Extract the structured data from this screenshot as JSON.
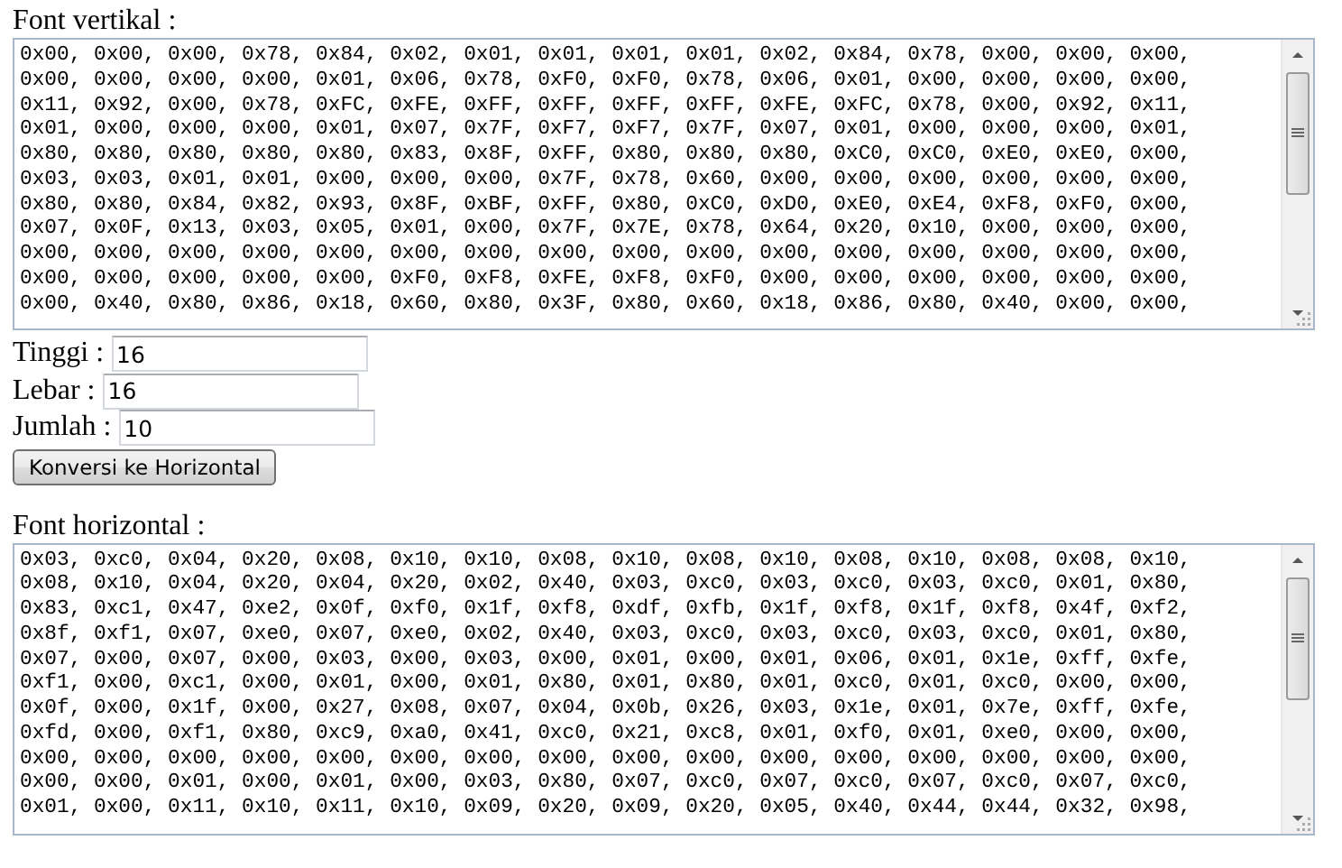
{
  "vertical": {
    "label": "Font vertikal :",
    "lines": [
      "0x00, 0x00, 0x00, 0x78, 0x84, 0x02, 0x01, 0x01, 0x01, 0x01, 0x02, 0x84, 0x78, 0x00, 0x00, 0x00,",
      "0x00, 0x00, 0x00, 0x00, 0x01, 0x06, 0x78, 0xF0, 0xF0, 0x78, 0x06, 0x01, 0x00, 0x00, 0x00, 0x00,",
      "0x11, 0x92, 0x00, 0x78, 0xFC, 0xFE, 0xFF, 0xFF, 0xFF, 0xFF, 0xFE, 0xFC, 0x78, 0x00, 0x92, 0x11,",
      "0x01, 0x00, 0x00, 0x00, 0x01, 0x07, 0x7F, 0xF7, 0xF7, 0x7F, 0x07, 0x01, 0x00, 0x00, 0x00, 0x01,",
      "0x80, 0x80, 0x80, 0x80, 0x80, 0x83, 0x8F, 0xFF, 0x80, 0x80, 0x80, 0xC0, 0xC0, 0xE0, 0xE0, 0x00,",
      "0x03, 0x03, 0x01, 0x01, 0x00, 0x00, 0x00, 0x7F, 0x78, 0x60, 0x00, 0x00, 0x00, 0x00, 0x00, 0x00,",
      "0x80, 0x80, 0x84, 0x82, 0x93, 0x8F, 0xBF, 0xFF, 0x80, 0xC0, 0xD0, 0xE0, 0xE4, 0xF8, 0xF0, 0x00,",
      "0x07, 0x0F, 0x13, 0x03, 0x05, 0x01, 0x00, 0x7F, 0x7E, 0x78, 0x64, 0x20, 0x10, 0x00, 0x00, 0x00,",
      "0x00, 0x00, 0x00, 0x00, 0x00, 0x00, 0x00, 0x00, 0x00, 0x00, 0x00, 0x00, 0x00, 0x00, 0x00, 0x00,",
      "0x00, 0x00, 0x00, 0x00, 0x00, 0xF0, 0xF8, 0xFE, 0xF8, 0xF0, 0x00, 0x00, 0x00, 0x00, 0x00, 0x00,",
      "0x00, 0x40, 0x80, 0x86, 0x18, 0x60, 0x80, 0x3F, 0x80, 0x60, 0x18, 0x86, 0x80, 0x40, 0x00, 0x00,"
    ]
  },
  "fields": [
    {
      "label": "Tinggi :",
      "value": "16"
    },
    {
      "label": "Lebar :",
      "value": "16"
    },
    {
      "label": "Jumlah :",
      "value": "10"
    }
  ],
  "button": "Konversi ke Horizontal",
  "horizontal": {
    "label": "Font horizontal :",
    "lines": [
      "0x03, 0xc0, 0x04, 0x20, 0x08, 0x10, 0x10, 0x08, 0x10, 0x08, 0x10, 0x08, 0x10, 0x08, 0x08, 0x10,",
      "0x08, 0x10, 0x04, 0x20, 0x04, 0x20, 0x02, 0x40, 0x03, 0xc0, 0x03, 0xc0, 0x03, 0xc0, 0x01, 0x80,",
      "0x83, 0xc1, 0x47, 0xe2, 0x0f, 0xf0, 0x1f, 0xf8, 0xdf, 0xfb, 0x1f, 0xf8, 0x1f, 0xf8, 0x4f, 0xf2,",
      "0x8f, 0xf1, 0x07, 0xe0, 0x07, 0xe0, 0x02, 0x40, 0x03, 0xc0, 0x03, 0xc0, 0x03, 0xc0, 0x01, 0x80,",
      "0x07, 0x00, 0x07, 0x00, 0x03, 0x00, 0x03, 0x00, 0x01, 0x00, 0x01, 0x06, 0x01, 0x1e, 0xff, 0xfe,",
      "0xf1, 0x00, 0xc1, 0x00, 0x01, 0x00, 0x01, 0x80, 0x01, 0x80, 0x01, 0xc0, 0x01, 0xc0, 0x00, 0x00,",
      "0x0f, 0x00, 0x1f, 0x00, 0x27, 0x08, 0x07, 0x04, 0x0b, 0x26, 0x03, 0x1e, 0x01, 0x7e, 0xff, 0xfe,",
      "0xfd, 0x00, 0xf1, 0x80, 0xc9, 0xa0, 0x41, 0xc0, 0x21, 0xc8, 0x01, 0xf0, 0x01, 0xe0, 0x00, 0x00,",
      "0x00, 0x00, 0x00, 0x00, 0x00, 0x00, 0x00, 0x00, 0x00, 0x00, 0x00, 0x00, 0x00, 0x00, 0x00, 0x00,",
      "0x00, 0x00, 0x01, 0x00, 0x01, 0x00, 0x03, 0x80, 0x07, 0xc0, 0x07, 0xc0, 0x07, 0xc0, 0x07, 0xc0,",
      "0x01, 0x00, 0x11, 0x10, 0x11, 0x10, 0x09, 0x20, 0x09, 0x20, 0x05, 0x40, 0x44, 0x44, 0x32, 0x98,"
    ]
  }
}
